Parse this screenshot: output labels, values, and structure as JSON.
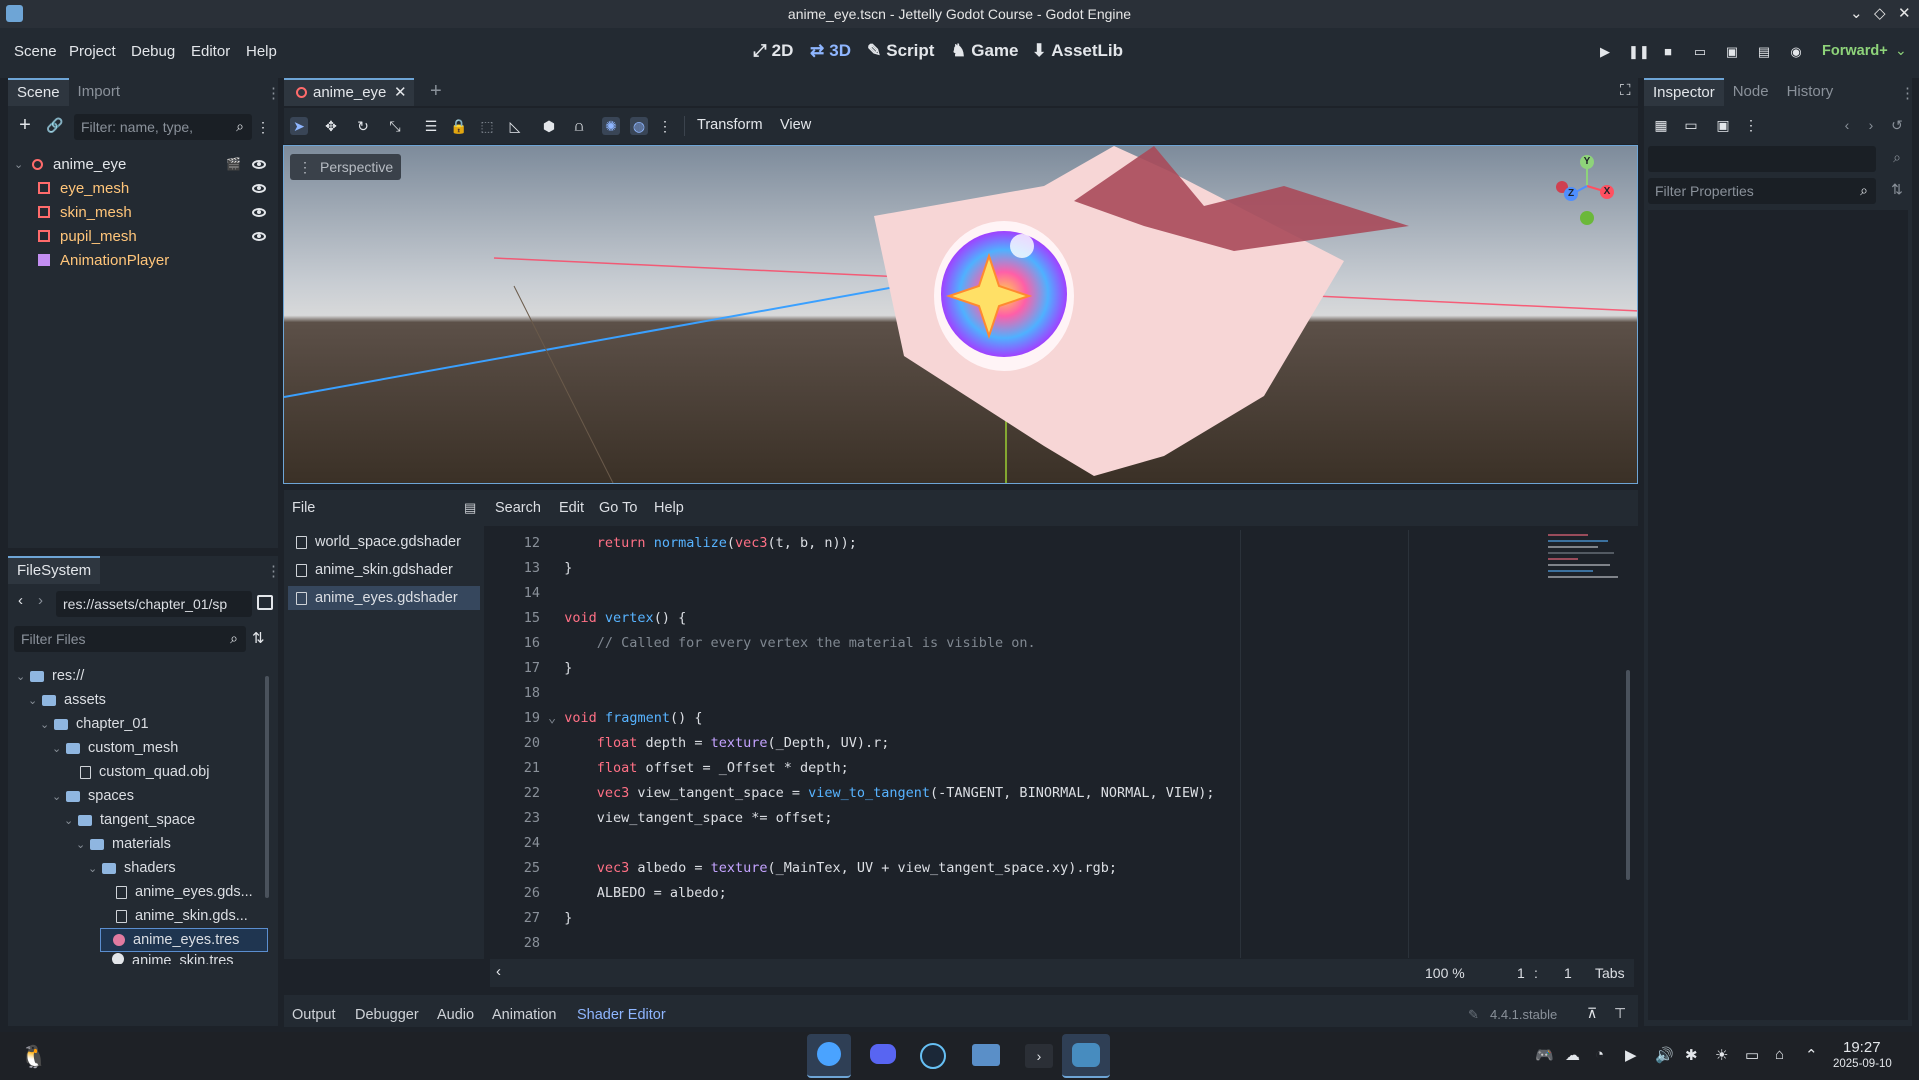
{
  "window": {
    "title": "anime_eye.tscn - Jettelly Godot Course - Godot Engine"
  },
  "menu": [
    "Scene",
    "Project",
    "Debug",
    "Editor",
    "Help"
  ],
  "workspaces": [
    {
      "label": "2D",
      "active": false
    },
    {
      "label": "3D",
      "active": true
    },
    {
      "label": "Script",
      "active": false
    },
    {
      "label": "Game",
      "active": false
    },
    {
      "label": "AssetLib",
      "active": false
    }
  ],
  "renderer": "Forward+",
  "scene_dock": {
    "tabs": [
      "Scene",
      "Import"
    ],
    "filter_placeholder": "Filter: name, type,",
    "nodes": [
      {
        "name": "anime_eye",
        "color": "#e3e6ea"
      },
      {
        "name": "eye_mesh",
        "color": "#ffc57a"
      },
      {
        "name": "skin_mesh",
        "color": "#ffc57a"
      },
      {
        "name": "pupil_mesh",
        "color": "#ffc57a"
      },
      {
        "name": "AnimationPlayer",
        "color": "#ffc57a"
      }
    ]
  },
  "filesystem": {
    "tab": "FileSystem",
    "path": "res://assets/chapter_01/sp",
    "filter_placeholder": "Filter Files",
    "items": [
      {
        "label": "res://",
        "type": "folder"
      },
      {
        "label": "assets",
        "type": "folder"
      },
      {
        "label": "chapter_01",
        "type": "folder"
      },
      {
        "label": "custom_mesh",
        "type": "folder"
      },
      {
        "label": "custom_quad.obj",
        "type": "mesh"
      },
      {
        "label": "spaces",
        "type": "folder"
      },
      {
        "label": "tangent_space",
        "type": "folder"
      },
      {
        "label": "materials",
        "type": "folder"
      },
      {
        "label": "shaders",
        "type": "folder"
      },
      {
        "label": "anime_eyes.gds...",
        "type": "file"
      },
      {
        "label": "anime_skin.gds...",
        "type": "file"
      },
      {
        "label": "anime_eyes.tres",
        "type": "resource"
      },
      {
        "label": "anime_skin.tres",
        "type": "resource"
      }
    ]
  },
  "viewport": {
    "scene_tab": "anime_eye",
    "toolbar_menus": [
      "Transform",
      "View"
    ],
    "perspective_label": "Perspective",
    "gizmo_axes": [
      "Y",
      "Z",
      "X"
    ]
  },
  "shader_editor": {
    "menus": [
      "File",
      "Search",
      "Edit",
      "Go To",
      "Help"
    ],
    "files": [
      "world_space.gdshader",
      "anime_skin.gdshader",
      "anime_eyes.gdshader"
    ],
    "selected_file": "anime_eyes.gdshader",
    "zoom": "100 %",
    "cursor_line": "1",
    "cursor_col": "1",
    "indent_mode": "Tabs",
    "line_numbers": [
      "12",
      "13",
      "14",
      "15",
      "16",
      "17",
      "18",
      "19",
      "20",
      "21",
      "22",
      "23",
      "24",
      "25",
      "26",
      "27",
      "28"
    ]
  },
  "bottom_panel": {
    "tabs": [
      "Output",
      "Debugger",
      "Audio",
      "Animation",
      "Shader Editor"
    ],
    "active_tab": "Shader Editor",
    "version": "4.4.1.stable"
  },
  "inspector": {
    "tabs": [
      "Inspector",
      "Node",
      "History"
    ],
    "filter_placeholder": "Filter Properties"
  },
  "taskbar": {
    "time": "19:27",
    "date": "2025-09-10"
  }
}
